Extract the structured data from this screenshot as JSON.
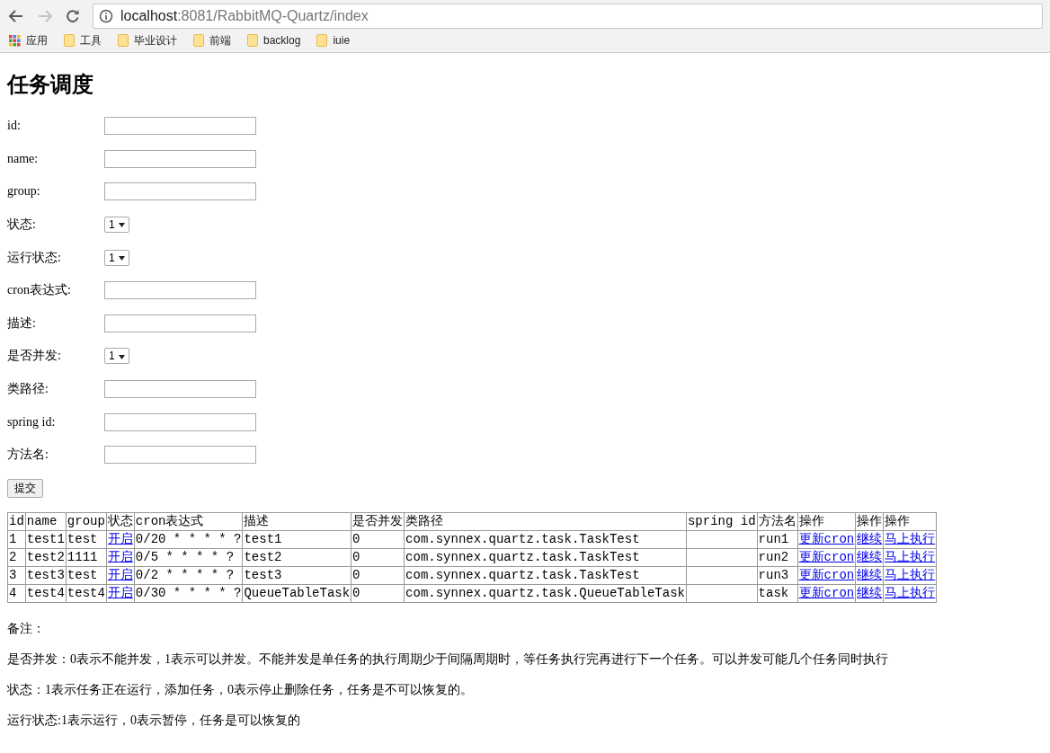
{
  "browser": {
    "url_host": "localhost",
    "url_path": ":8081/RabbitMQ-Quartz/index",
    "bookmarks": [
      {
        "kind": "apps",
        "label": "应用"
      },
      {
        "kind": "folder",
        "label": "工具"
      },
      {
        "kind": "folder",
        "label": "毕业设计"
      },
      {
        "kind": "folder",
        "label": "前端"
      },
      {
        "kind": "folder",
        "label": "backlog"
      },
      {
        "kind": "folder",
        "label": "iuie"
      }
    ]
  },
  "title": "任务调度",
  "form": {
    "fields": [
      {
        "kind": "text",
        "label": "id:"
      },
      {
        "kind": "text",
        "label": "name:"
      },
      {
        "kind": "text",
        "label": "group:"
      },
      {
        "kind": "select",
        "label": "状态:",
        "value": "1"
      },
      {
        "kind": "select",
        "label": "运行状态:",
        "value": "1"
      },
      {
        "kind": "text",
        "label": "cron表达式:"
      },
      {
        "kind": "text",
        "label": "描述:"
      },
      {
        "kind": "select",
        "label": "是否并发:",
        "value": "1"
      },
      {
        "kind": "text",
        "label": "类路径:"
      },
      {
        "kind": "text",
        "label": "spring id:"
      },
      {
        "kind": "text",
        "label": "方法名:"
      }
    ],
    "submit": "提交"
  },
  "table": {
    "columns": [
      "id",
      "name",
      "group",
      "状态",
      "cron表达式",
      "描述",
      "是否并发",
      "类路径",
      "spring id",
      "方法名",
      "操作",
      "操作",
      "操作"
    ],
    "rows": [
      {
        "cells": [
          {
            "kind": "text",
            "text": "1"
          },
          {
            "kind": "text",
            "text": "test1"
          },
          {
            "kind": "text",
            "text": "test"
          },
          {
            "kind": "link",
            "text": "开启"
          },
          {
            "kind": "text",
            "text": "0/20 * * * * ?"
          },
          {
            "kind": "text",
            "text": "test1"
          },
          {
            "kind": "text",
            "text": "0"
          },
          {
            "kind": "text",
            "text": "com.synnex.quartz.task.TaskTest"
          },
          {
            "kind": "text",
            "text": ""
          },
          {
            "kind": "text",
            "text": "run1"
          },
          {
            "kind": "link",
            "text": "更新cron"
          },
          {
            "kind": "link",
            "text": "继续"
          },
          {
            "kind": "link",
            "text": "马上执行"
          }
        ]
      },
      {
        "cells": [
          {
            "kind": "text",
            "text": "2"
          },
          {
            "kind": "text",
            "text": "test2"
          },
          {
            "kind": "text",
            "text": "1111"
          },
          {
            "kind": "link",
            "text": "开启"
          },
          {
            "kind": "text",
            "text": "0/5 * * * * ?"
          },
          {
            "kind": "text",
            "text": "test2"
          },
          {
            "kind": "text",
            "text": "0"
          },
          {
            "kind": "text",
            "text": "com.synnex.quartz.task.TaskTest"
          },
          {
            "kind": "text",
            "text": ""
          },
          {
            "kind": "text",
            "text": "run2"
          },
          {
            "kind": "link",
            "text": "更新cron"
          },
          {
            "kind": "link",
            "text": "继续"
          },
          {
            "kind": "link",
            "text": "马上执行"
          }
        ]
      },
      {
        "cells": [
          {
            "kind": "text",
            "text": "3"
          },
          {
            "kind": "text",
            "text": "test3"
          },
          {
            "kind": "text",
            "text": "test"
          },
          {
            "kind": "link",
            "text": "开启"
          },
          {
            "kind": "text",
            "text": "0/2 * * * * ?"
          },
          {
            "kind": "text",
            "text": "test3"
          },
          {
            "kind": "text",
            "text": "0"
          },
          {
            "kind": "text",
            "text": "com.synnex.quartz.task.TaskTest"
          },
          {
            "kind": "text",
            "text": ""
          },
          {
            "kind": "text",
            "text": "run3"
          },
          {
            "kind": "link",
            "text": "更新cron"
          },
          {
            "kind": "link",
            "text": "继续"
          },
          {
            "kind": "link",
            "text": "马上执行"
          }
        ]
      },
      {
        "cells": [
          {
            "kind": "text",
            "text": "4"
          },
          {
            "kind": "text",
            "text": "test4"
          },
          {
            "kind": "text",
            "text": "test4"
          },
          {
            "kind": "link",
            "text": "开启"
          },
          {
            "kind": "text",
            "text": "0/30 * * * * ?"
          },
          {
            "kind": "text",
            "text": "QueueTableTask"
          },
          {
            "kind": "text",
            "text": "0"
          },
          {
            "kind": "text",
            "text": "com.synnex.quartz.task.QueueTableTask"
          },
          {
            "kind": "text",
            "text": ""
          },
          {
            "kind": "text",
            "text": "task"
          },
          {
            "kind": "link",
            "text": "更新cron"
          },
          {
            "kind": "link",
            "text": "继续"
          },
          {
            "kind": "link",
            "text": "马上执行"
          }
        ]
      }
    ]
  },
  "notes": [
    "备注：",
    "是否并发：0表示不能并发，1表示可以并发。不能并发是单任务的执行周期少于间隔周期时，等任务执行完再进行下一个任务。可以并发可能几个任务同时执行",
    "状态：1表示任务正在运行，添加任务，0表示停止删除任务，任务是不可以恢复的。",
    "运行状态:1表示运行，0表示暂停，任务是可以恢复的"
  ]
}
